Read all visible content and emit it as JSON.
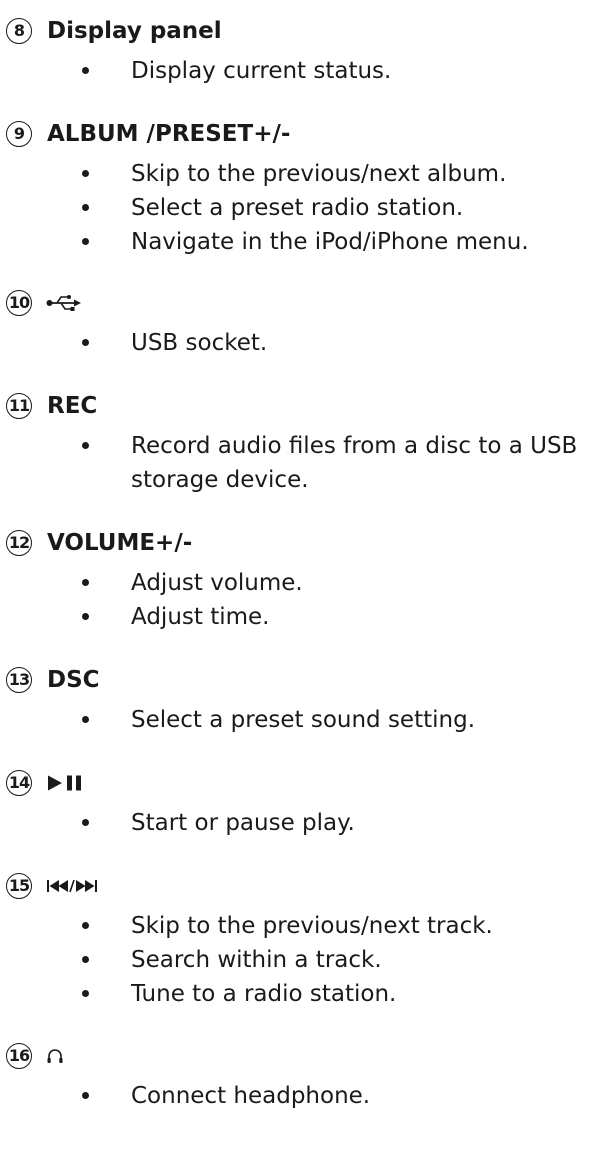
{
  "items": [
    {
      "number": "8",
      "title": "Display panel",
      "icon": "",
      "bullets": [
        "Display current status."
      ]
    },
    {
      "number": "9",
      "title": "ALBUM /PRESET+/-",
      "icon": "",
      "bullets": [
        "Skip to the previous/next album.",
        "Select a preset radio station.",
        "Navigate in the iPod/iPhone menu."
      ]
    },
    {
      "number": "10",
      "title": "",
      "icon": "usb-icon",
      "bullets": [
        "USB socket."
      ]
    },
    {
      "number": "11",
      "title": "REC",
      "icon": "",
      "bullets": [
        "Record audio files from a disc to a USB storage device."
      ]
    },
    {
      "number": "12",
      "title": "VOLUME+/-",
      "icon": "",
      "bullets": [
        "Adjust volume.",
        "Adjust time."
      ]
    },
    {
      "number": "13",
      "title": "DSC",
      "icon": "",
      "bullets": [
        "Select a preset sound setting."
      ]
    },
    {
      "number": "14",
      "title": "",
      "icon": "play-pause-icon",
      "bullets": [
        "Start or pause play."
      ]
    },
    {
      "number": "15",
      "title": "",
      "icon": "previous-next-icon",
      "bullets": [
        "Skip to the previous/next track.",
        "Search within a track.",
        "Tune to a radio station."
      ]
    },
    {
      "number": "16",
      "title": "",
      "icon": "headphone-icon",
      "bullets": [
        "Connect headphone."
      ]
    }
  ]
}
